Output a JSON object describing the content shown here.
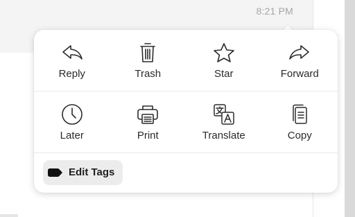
{
  "message": {
    "timestamp": "8:21 PM"
  },
  "popover": {
    "actions_row1": [
      {
        "label": "Reply",
        "icon": "reply-icon"
      },
      {
        "label": "Trash",
        "icon": "trash-icon"
      },
      {
        "label": "Star",
        "icon": "star-icon"
      },
      {
        "label": "Forward",
        "icon": "forward-icon"
      }
    ],
    "actions_row2": [
      {
        "label": "Later",
        "icon": "clock-icon"
      },
      {
        "label": "Print",
        "icon": "printer-icon"
      },
      {
        "label": "Translate",
        "icon": "translate-icon"
      },
      {
        "label": "Copy",
        "icon": "copy-icon"
      }
    ],
    "edit_tags": {
      "label": "Edit Tags",
      "icon": "tag-icon"
    }
  },
  "colors": {
    "icon_stroke": "#2b2b2b",
    "label_text": "#2a2a2a",
    "timestamp": "#a6a6a6",
    "edit_tags_bg": "#ececec"
  }
}
